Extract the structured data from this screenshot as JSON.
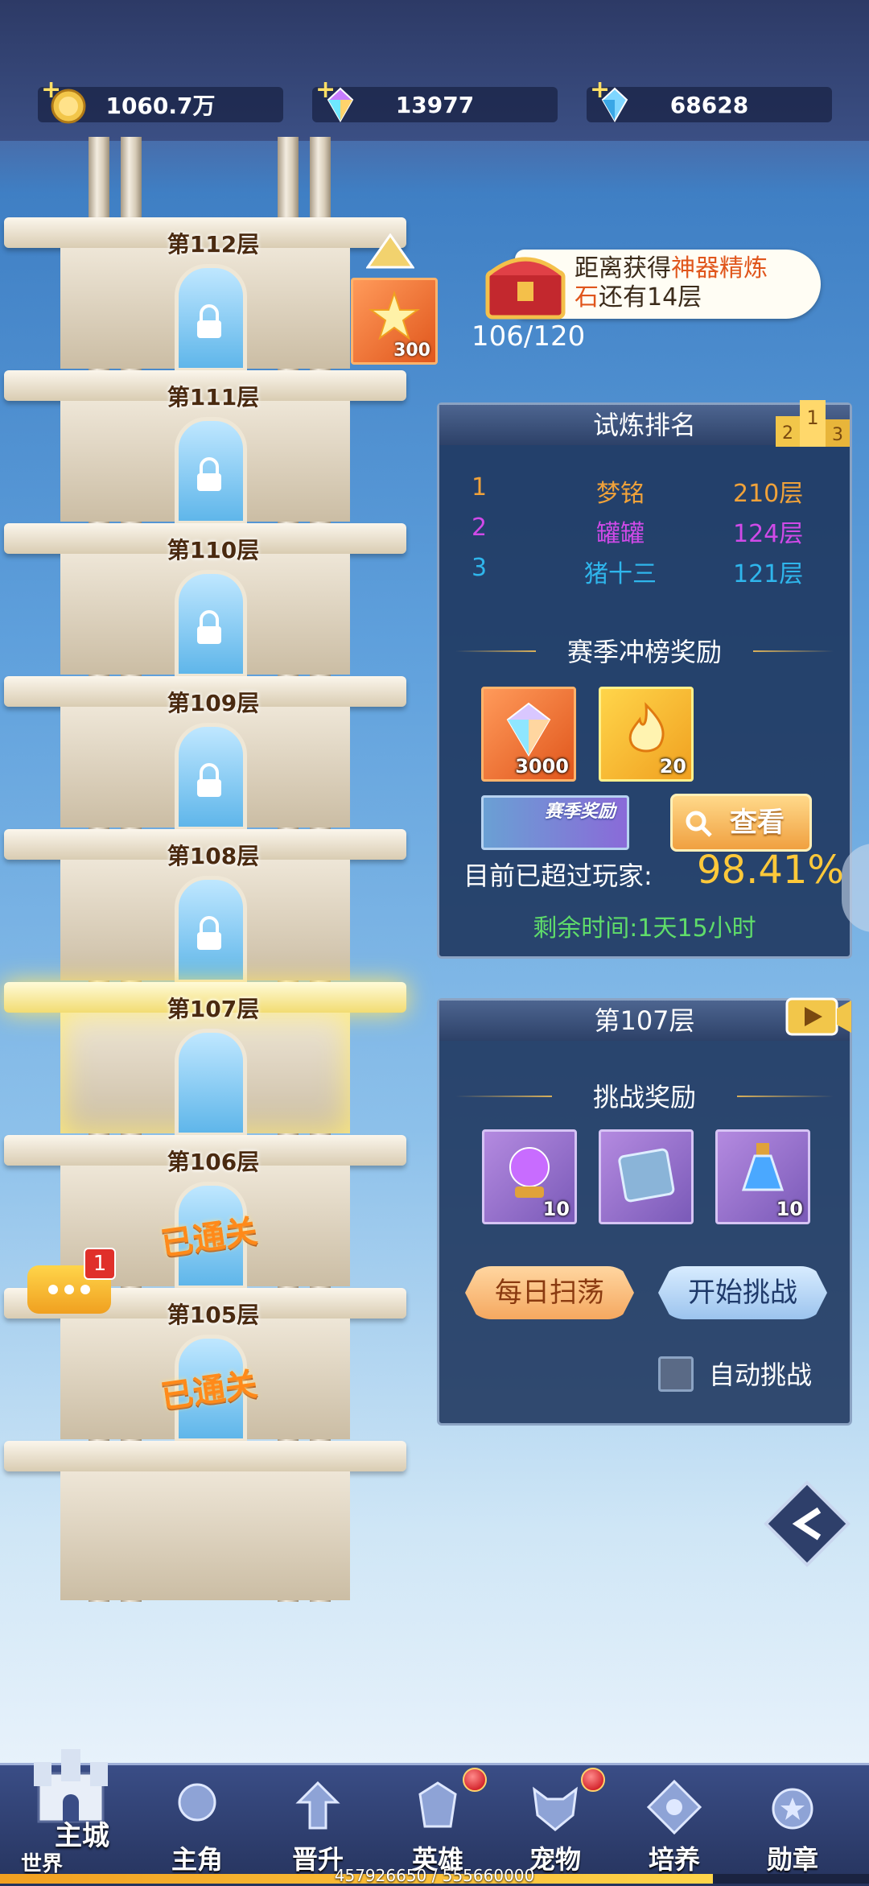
{
  "resources": {
    "gold": "1060.7万",
    "gems": "13977",
    "crystals": "68628"
  },
  "tower": {
    "floors": [
      {
        "label": "第112层",
        "state": "locked"
      },
      {
        "label": "第111层",
        "state": "locked"
      },
      {
        "label": "第110层",
        "state": "locked"
      },
      {
        "label": "第109层",
        "state": "locked"
      },
      {
        "label": "第108层",
        "state": "locked"
      },
      {
        "label": "第107层",
        "state": "current"
      },
      {
        "label": "第106层",
        "state": "passed"
      },
      {
        "label": "第105层",
        "state": "passed"
      }
    ],
    "passed_stamp": "已通关",
    "floor_reward_count": "300"
  },
  "chest": {
    "text_prefix": "距离获得",
    "text_highlight": "神器精炼",
    "text_highlight2": "石",
    "text_suffix": "还有14层",
    "progress": "106/120"
  },
  "ranking": {
    "title": "试炼排名",
    "rows": [
      {
        "rank": "1",
        "name": "梦铭",
        "floor": "210层",
        "color": "#f0a23a"
      },
      {
        "rank": "2",
        "name": "罐罐",
        "floor": "124层",
        "color": "#d04ae8"
      },
      {
        "rank": "3",
        "name": "猪十三",
        "floor": "121层",
        "color": "#2fb6ec"
      }
    ],
    "season_title": "赛季冲榜奖励",
    "season_rewards": [
      {
        "count": "3000",
        "icon": "diamond-icon"
      },
      {
        "count": "20",
        "icon": "flame-essence-icon"
      }
    ],
    "season_btn": "赛季奖励",
    "view_btn": "查看",
    "surpass_label": "目前已超过玩家:",
    "surpass_value": "98.41%",
    "remaining": "剩余时间:1天15小时"
  },
  "challenge": {
    "title": "第107层",
    "reward_title": "挑战奖励",
    "rewards": [
      {
        "count": "10",
        "icon": "orb-icon"
      },
      {
        "count": "",
        "icon": "card-icon"
      },
      {
        "count": "10",
        "icon": "potion-icon"
      }
    ],
    "sweep_btn": "每日扫荡",
    "start_btn": "开始挑战",
    "auto_label": "自动挑战"
  },
  "chat": {
    "badge": "1"
  },
  "nav": [
    {
      "label": "主城",
      "sub": "世界",
      "icon": "castle-icon"
    },
    {
      "label": "主角",
      "icon": "protagonist-icon"
    },
    {
      "label": "晋升",
      "icon": "promotion-icon"
    },
    {
      "label": "英雄",
      "icon": "hero-icon",
      "dot": true
    },
    {
      "label": "宠物",
      "icon": "pet-icon",
      "dot": true
    },
    {
      "label": "培养",
      "icon": "train-icon"
    },
    {
      "label": "勋章",
      "icon": "medal-icon"
    }
  ],
  "exp_text": "457926650 / 555660000"
}
